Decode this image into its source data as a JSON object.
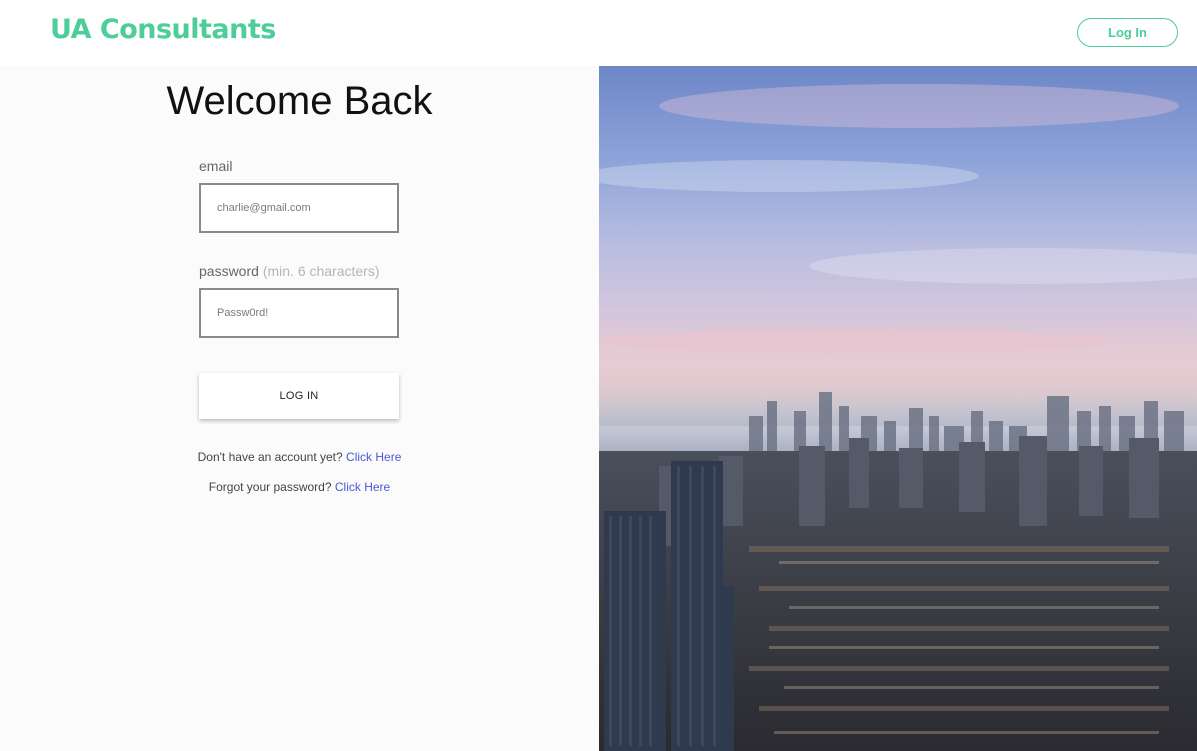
{
  "header": {
    "brand": "UA Consultants",
    "login_label": "Log In"
  },
  "form": {
    "title": "Welcome Back",
    "email_label": "email",
    "email_placeholder": "charlie@gmail.com",
    "password_label": "password",
    "password_hint": "(min. 6 characters)",
    "password_placeholder": "Passw0rd!",
    "submit_label": "LOG IN",
    "signup_prompt": "Don't have an account yet?",
    "signup_link": "Click Here",
    "forgot_prompt": "Forgot your password?",
    "forgot_link": "Click Here"
  },
  "colors": {
    "brand": "#4ccd99",
    "link": "#4a57d6"
  },
  "hero": {
    "image": "city-skyline-photo"
  }
}
